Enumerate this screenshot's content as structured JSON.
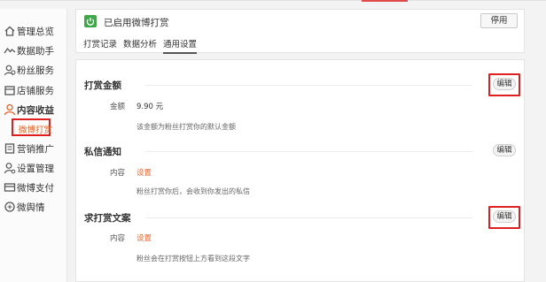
{
  "sidebar": {
    "items": [
      {
        "label": "管理总览",
        "icon": "home-icon"
      },
      {
        "label": "数据助手",
        "icon": "chart-line-icon"
      },
      {
        "label": "粉丝服务",
        "icon": "fans-icon"
      },
      {
        "label": "店铺服务",
        "icon": "shop-icon"
      },
      {
        "label": "内容收益",
        "icon": "user-icon"
      },
      {
        "label": "营销推广",
        "icon": "marketing-icon"
      },
      {
        "label": "设置管理",
        "icon": "settings-user-icon"
      },
      {
        "label": "微博支付",
        "icon": "payment-icon"
      },
      {
        "label": "微舆情",
        "icon": "opinion-icon"
      }
    ],
    "sub_item": "微博打赏"
  },
  "header": {
    "title": "已启用微博打赏",
    "disable_button": "停用",
    "tabs": [
      "打赏记录",
      "数据分析",
      "通用设置"
    ],
    "active_tab": "通用设置"
  },
  "sections": [
    {
      "title": "打赏金额",
      "edit": "编辑",
      "field_label": "金额",
      "field_value": "9.90 元",
      "desc": "该金额为粉丝打赏你的默认金额"
    },
    {
      "title": "私信通知",
      "edit": "编辑",
      "field_label": "内容",
      "field_value": "设置",
      "desc": "粉丝打赏你后，会收到你发出的私信"
    },
    {
      "title": "求打赏文案",
      "edit": "编辑",
      "field_label": "内容",
      "field_value": "设置",
      "desc": "粉丝会在打赏按钮上方看到这段文字"
    }
  ],
  "colors": {
    "accent": "#e8632a",
    "highlight": "#e02020",
    "power": "#3fa64a"
  }
}
